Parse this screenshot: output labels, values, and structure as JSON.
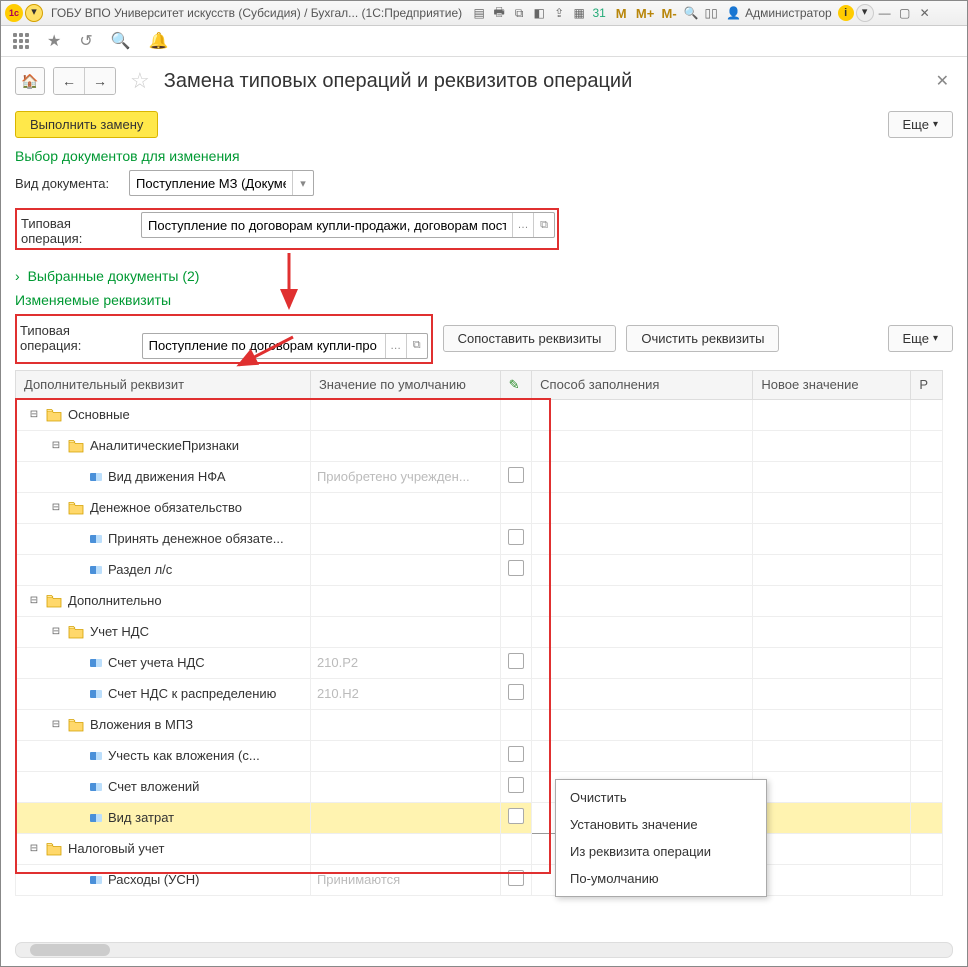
{
  "titlebar": {
    "text": "ГОБУ ВПО Университет искусств (Субсидия) / Бухгал...  (1С:Предприятие)",
    "user": "Администратор"
  },
  "page": {
    "title": "Замена типовых операций и реквизитов операций",
    "run_btn": "Выполнить замену",
    "more_btn": "Еще"
  },
  "filter": {
    "section_title": "Выбор документов для изменения",
    "doc_type_label": "Вид документа:",
    "doc_type_value": "Поступление МЗ (Докуме",
    "op1_label": "Типовая операция:",
    "op1_value": "Поступление по договорам купли-продажи, договорам поста",
    "selected_docs": "Выбранные документы (2)"
  },
  "change": {
    "section_title": "Изменяемые реквизиты",
    "op2_label": "Типовая операция:",
    "op2_value": "Поступление по договорам купли-про",
    "map_btn": "Сопоставить реквизиты",
    "clear_btn": "Очистить реквизиты",
    "more_btn": "Еще"
  },
  "columns": {
    "c1": "Дополнительный реквизит",
    "c2": "Значение по умолчанию",
    "c3": "",
    "c4": "Способ заполнения",
    "c5": "Новое значение",
    "c6": "Р"
  },
  "tree": [
    {
      "lvl": 1,
      "type": "folder",
      "label": "Основные"
    },
    {
      "lvl": 2,
      "type": "folder",
      "label": "АналитическиеПризнаки"
    },
    {
      "lvl": 3,
      "type": "leaf",
      "label": "Вид движения НФА",
      "def": "Приобретено учрежден...",
      "chk": true
    },
    {
      "lvl": 2,
      "type": "folder",
      "label": "Денежное обязательство",
      "notoggle": false
    },
    {
      "lvl": 3,
      "type": "leaf",
      "label": "Принять денежное обязате...",
      "def": "",
      "chk": true
    },
    {
      "lvl": 3,
      "type": "leaf",
      "label": "Раздел л/с",
      "def": "",
      "chk": true
    },
    {
      "lvl": 1,
      "type": "folder",
      "label": "Дополнительно"
    },
    {
      "lvl": 2,
      "type": "folder",
      "label": "Учет НДС"
    },
    {
      "lvl": 3,
      "type": "leaf",
      "label": "Счет учета НДС",
      "def": "210.Р2",
      "chk": true
    },
    {
      "lvl": 3,
      "type": "leaf",
      "label": "Счет НДС к распределению",
      "def": "210.Н2",
      "chk": true
    },
    {
      "lvl": 2,
      "type": "folder",
      "label": "Вложения в МПЗ"
    },
    {
      "lvl": 3,
      "type": "leaf",
      "label": "Учесть как вложения (с...",
      "def": "",
      "chk": true
    },
    {
      "lvl": 3,
      "type": "leaf",
      "label": "Счет вложений",
      "def": "",
      "chk": true
    },
    {
      "lvl": 3,
      "type": "leaf",
      "label": "Вид затрат",
      "def": "",
      "chk": true,
      "sel": true
    },
    {
      "lvl": 1,
      "type": "folder",
      "label": "Налоговый учет"
    },
    {
      "lvl": 3,
      "type": "leaf",
      "label": "Расходы (УСН)",
      "def": "Принимаются",
      "chk": true
    }
  ],
  "ctx": {
    "i1": "Очистить",
    "i2": "Установить значение",
    "i3": "Из реквизита операции",
    "i4": "По-умолчанию"
  }
}
